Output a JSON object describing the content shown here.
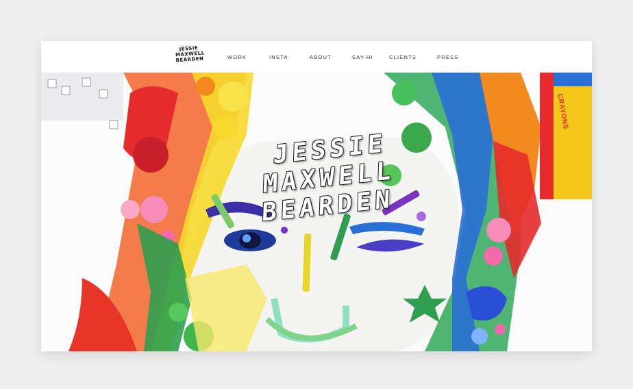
{
  "site": {
    "logo_lines": [
      "JESSIE",
      "MAXWELL",
      "BEARDEN"
    ]
  },
  "nav": {
    "items": [
      {
        "label": "WORK"
      },
      {
        "label": "INSTA"
      },
      {
        "label": "ABOUT"
      },
      {
        "label": "SAY-HI"
      },
      {
        "label": "CLIENTS"
      },
      {
        "label": "PRESS"
      }
    ]
  },
  "hero": {
    "title_lines": [
      "JESSIE",
      "MAXWELL",
      "BEARDEN"
    ],
    "crayon_box_text": "CRAYONS"
  },
  "colors": {
    "page_bg": "#efefef",
    "red": "#e52b2b",
    "orange": "#f28a1f",
    "yellow": "#f6d92c",
    "green": "#3aa84a",
    "blue": "#2a6fd6",
    "purple": "#7a34c2",
    "pink": "#f26aa8"
  }
}
